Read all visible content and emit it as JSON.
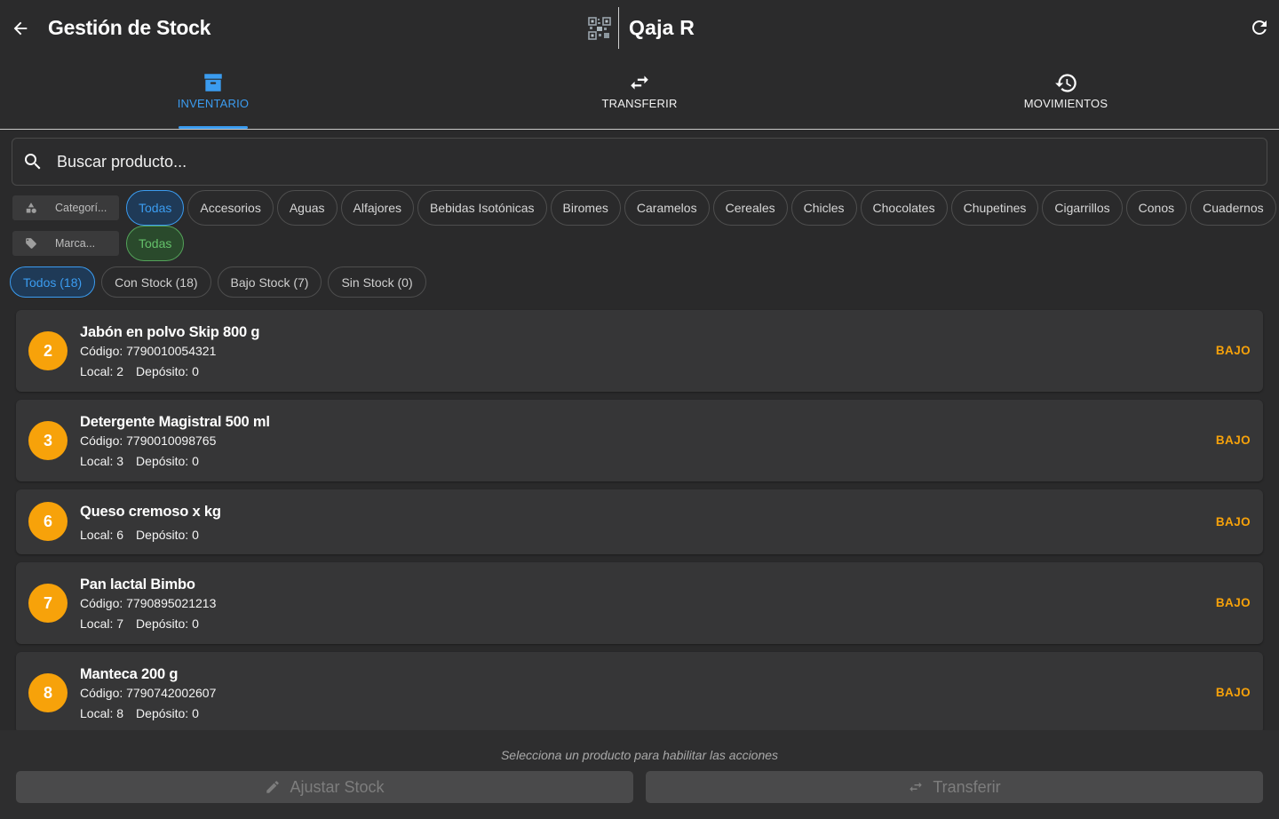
{
  "header": {
    "title": "Gestión de Stock",
    "brand": "Qaja R",
    "back_icon": "arrow-left-icon",
    "refresh_icon": "refresh-icon"
  },
  "tabs": [
    {
      "label": "INVENTARIO",
      "icon": "archive-box-icon",
      "active": true
    },
    {
      "label": "TRANSFERIR",
      "icon": "swap-arrows-icon",
      "active": false
    },
    {
      "label": "MOVIMIENTOS",
      "icon": "history-icon",
      "active": false
    }
  ],
  "search": {
    "placeholder": "Buscar producto..."
  },
  "filters": {
    "category_label": "Categoría",
    "category_label_truncated": "Categorí...",
    "brand_label_truncated": "Marca...",
    "categories": [
      "Todas",
      "Accesorios",
      "Aguas",
      "Alfajores",
      "Bebidas Isotónicas",
      "Biromes",
      "Caramelos",
      "Cereales",
      "Chicles",
      "Chocolates",
      "Chupetines",
      "Cigarrillos",
      "Conos",
      "Cuadernos"
    ],
    "brands": [
      "Todas"
    ]
  },
  "status_filters": [
    {
      "label": "Todos (18)",
      "active": true
    },
    {
      "label": "Con Stock (18)",
      "active": false
    },
    {
      "label": "Bajo Stock (7)",
      "active": false
    },
    {
      "label": "Sin Stock (0)",
      "active": false
    }
  ],
  "products": [
    {
      "qty": "2",
      "name": "Jabón en polvo Skip 800 g",
      "code": "Código: 7790010054321",
      "local": "Local: 2",
      "deposit": "Depósito: 0",
      "badge": "BAJO"
    },
    {
      "qty": "3",
      "name": "Detergente Magistral 500 ml",
      "code": "Código: 7790010098765",
      "local": "Local: 3",
      "deposit": "Depósito: 0",
      "badge": "BAJO"
    },
    {
      "qty": "6",
      "name": "Queso cremoso x kg",
      "code": "",
      "local": "Local: 6",
      "deposit": "Depósito: 0",
      "badge": "BAJO"
    },
    {
      "qty": "7",
      "name": "Pan lactal Bimbo",
      "code": "Código: 7790895021213",
      "local": "Local: 7",
      "deposit": "Depósito: 0",
      "badge": "BAJO"
    },
    {
      "qty": "8",
      "name": "Manteca 200 g",
      "code": "Código: 7790742002607",
      "local": "Local: 8",
      "deposit": "Depósito: 0",
      "badge": "BAJO"
    }
  ],
  "actions": {
    "hint": "Selecciona un producto para habilitar las acciones",
    "adjust_label": "Ajustar Stock",
    "transfer_label": "Transferir"
  },
  "colors": {
    "accent": "#3b9cf0",
    "warning": "#f7a20a",
    "success": "#64c06a",
    "background": "#2a2a2b"
  }
}
